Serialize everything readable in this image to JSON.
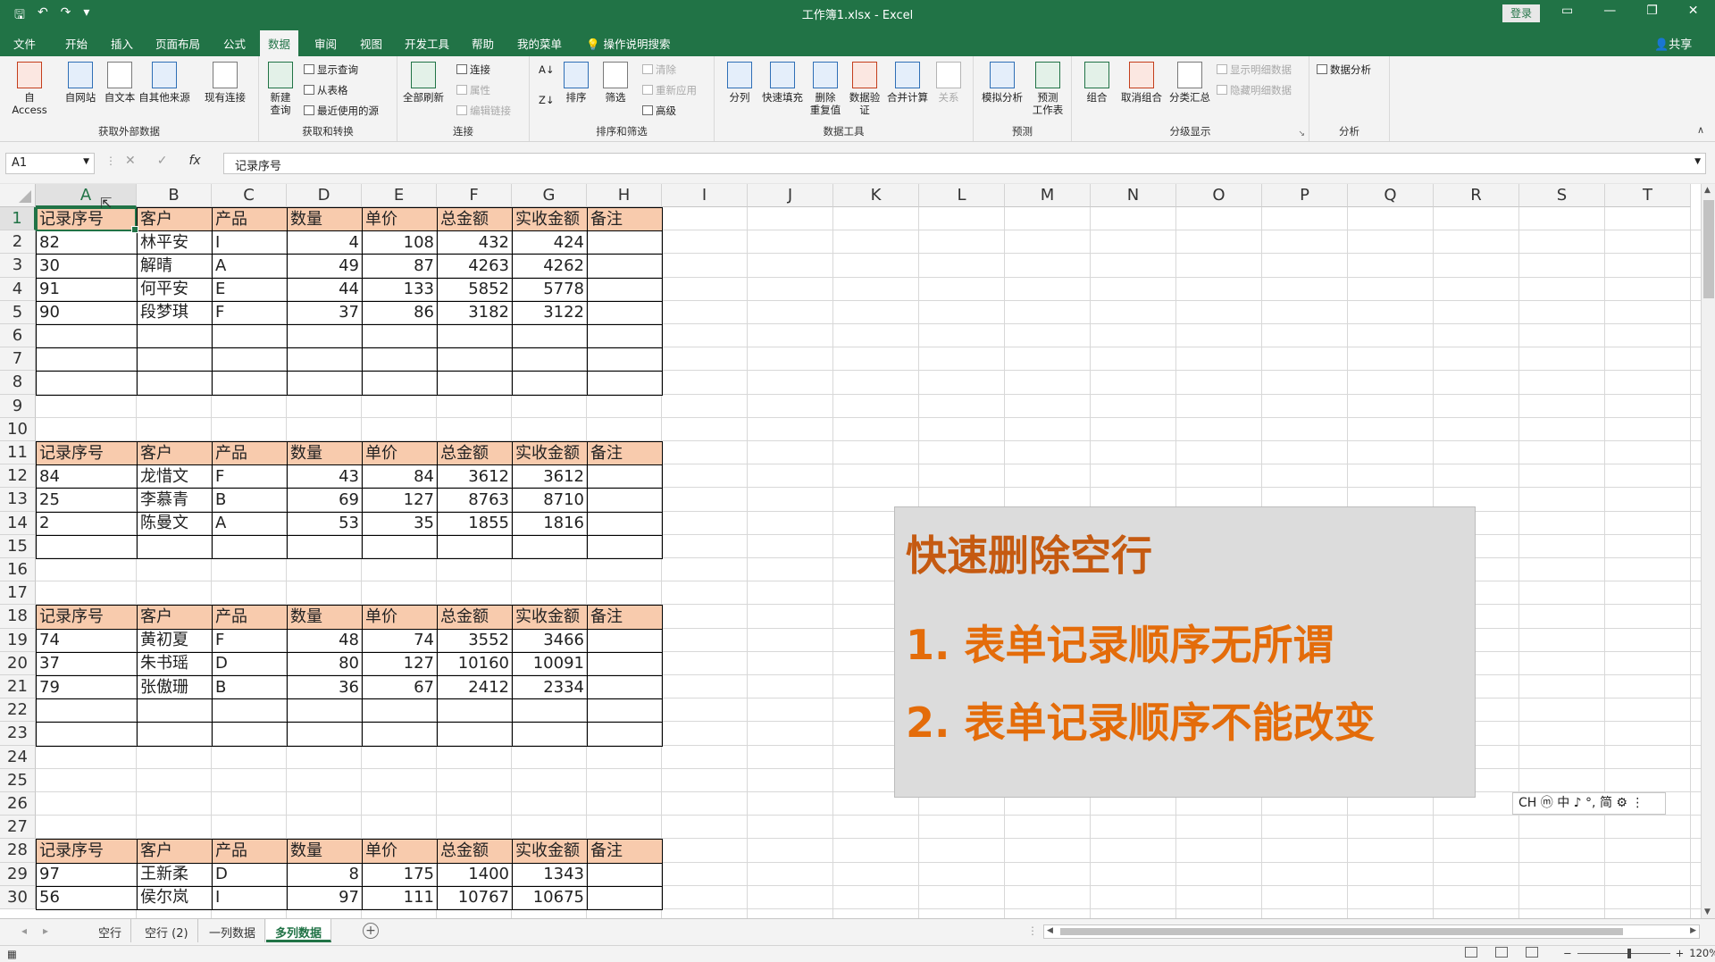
{
  "window": {
    "title": "工作簿1.xlsx  -  Excel",
    "login_label": "登录",
    "share_label": "共享"
  },
  "menu_tabs": [
    "文件",
    "开始",
    "插入",
    "页面布局",
    "公式",
    "数据",
    "审阅",
    "视图",
    "开发工具",
    "帮助",
    "我的菜单",
    "操作说明搜索"
  ],
  "active_tab": "数据",
  "ribbon": {
    "ext_data": {
      "label": "获取外部数据",
      "access": "自 Access",
      "web": "自网站",
      "text": "自文本",
      "other": "自其他来源",
      "existing": "现有连接"
    },
    "get_transform": {
      "label": "获取和转换",
      "new_query": "新建\n查询",
      "show_queries": "显示查询",
      "from_table": "从表格",
      "recent_sources": "最近使用的源"
    },
    "connections": {
      "label": "连接",
      "refresh_all": "全部刷新",
      "connections": "连接",
      "properties": "属性",
      "edit_links": "编辑链接"
    },
    "sort_filter": {
      "label": "排序和筛选",
      "sort": "排序",
      "filter": "筛选",
      "clear": "清除",
      "reapply": "重新应用",
      "advanced": "高级"
    },
    "data_tools": {
      "label": "数据工具",
      "text_to_columns": "分列",
      "flash_fill": "快速填充",
      "remove_duplicates": "删除\n重复值",
      "data_validation": "数据验\n证",
      "consolidate": "合并计算",
      "relationships": "关系"
    },
    "forecast": {
      "label": "预测",
      "what_if": "模拟分析",
      "forecast_sheet": "预测\n工作表"
    },
    "outline": {
      "label": "分级显示",
      "group": "组合",
      "ungroup": "取消组合",
      "subtotal": "分类汇总",
      "show_detail": "显示明细数据",
      "hide_detail": "隐藏明细数据"
    },
    "analysis": {
      "label": "分析",
      "data_analysis": "数据分析"
    }
  },
  "formula_bar": {
    "name_box": "A1",
    "content": "记录序号",
    "fx": "fx"
  },
  "columns": [
    "A",
    "B",
    "C",
    "D",
    "E",
    "F",
    "G",
    "H",
    "I",
    "J",
    "K",
    "L",
    "M",
    "N",
    "O",
    "P",
    "Q",
    "R",
    "S",
    "T"
  ],
  "rows": [
    "1",
    "2",
    "3",
    "4",
    "5",
    "6",
    "7",
    "8",
    "9",
    "10",
    "11",
    "12",
    "13",
    "14",
    "15",
    "16",
    "17",
    "18",
    "19",
    "20",
    "21",
    "22",
    "23",
    "24",
    "25",
    "26",
    "27",
    "28",
    "29",
    "30"
  ],
  "tables": [
    {
      "header": [
        "记录序号",
        "客户",
        "产品",
        "数量",
        "单价",
        "总金额",
        "实收金额",
        "备注"
      ],
      "rows": [
        [
          "82",
          "林平安",
          "I",
          "4",
          "108",
          "432",
          "424",
          ""
        ],
        [
          "30",
          "解晴",
          "A",
          "49",
          "87",
          "4263",
          "4262",
          ""
        ],
        [
          "91",
          "何平安",
          "E",
          "44",
          "133",
          "5852",
          "5778",
          ""
        ],
        [
          "90",
          "段梦琪",
          "F",
          "37",
          "86",
          "3182",
          "3122",
          ""
        ],
        [
          "",
          "",
          "",
          "",
          "",
          "",
          "",
          ""
        ],
        [
          "",
          "",
          "",
          "",
          "",
          "",
          "",
          ""
        ],
        [
          "",
          "",
          "",
          "",
          "",
          "",
          "",
          ""
        ]
      ]
    },
    {
      "header": [
        "记录序号",
        "客户",
        "产品",
        "数量",
        "单价",
        "总金额",
        "实收金额",
        "备注"
      ],
      "rows": [
        [
          "84",
          "龙惜文",
          "F",
          "43",
          "84",
          "3612",
          "3612",
          ""
        ],
        [
          "25",
          "李慕青",
          "B",
          "69",
          "127",
          "8763",
          "8710",
          ""
        ],
        [
          "2",
          "陈曼文",
          "A",
          "53",
          "35",
          "1855",
          "1816",
          ""
        ],
        [
          "",
          "",
          "",
          "",
          "",
          "",
          "",
          ""
        ]
      ]
    },
    {
      "header": [
        "记录序号",
        "客户",
        "产品",
        "数量",
        "单价",
        "总金额",
        "实收金额",
        "备注"
      ],
      "rows": [
        [
          "74",
          "黄初夏",
          "F",
          "48",
          "74",
          "3552",
          "3466",
          ""
        ],
        [
          "37",
          "朱书瑶",
          "D",
          "80",
          "127",
          "10160",
          "10091",
          ""
        ],
        [
          "79",
          "张傲珊",
          "B",
          "36",
          "67",
          "2412",
          "2334",
          ""
        ],
        [
          "",
          "",
          "",
          "",
          "",
          "",
          "",
          ""
        ],
        [
          "",
          "",
          "",
          "",
          "",
          "",
          "",
          ""
        ]
      ]
    },
    {
      "header": [
        "记录序号",
        "客户",
        "产品",
        "数量",
        "单价",
        "总金额",
        "实收金额",
        "备注"
      ],
      "rows": [
        [
          "97",
          "王新柔",
          "D",
          "8",
          "175",
          "1400",
          "1343",
          ""
        ],
        [
          "56",
          "侯尔岚",
          "I",
          "97",
          "111",
          "10767",
          "10675",
          ""
        ]
      ]
    }
  ],
  "overlay": {
    "title": "快速删除空行",
    "line1": "1. 表单记录顺序无所谓",
    "line2": "2. 表单记录顺序不能改变"
  },
  "ime_bar": "CH ⓜ 中 ♪ °, 简 ⚙ ⋮",
  "sheet_tabs": [
    "空行",
    "空行 (2)",
    "一列数据",
    "多列数据"
  ],
  "active_sheet": "多列数据",
  "status": {
    "zoom": "120%"
  },
  "colors": {
    "brand": "#217346",
    "header_fill": "#f8cbad",
    "overlay_title": "#c55a11",
    "overlay_text": "#e46c0a"
  }
}
